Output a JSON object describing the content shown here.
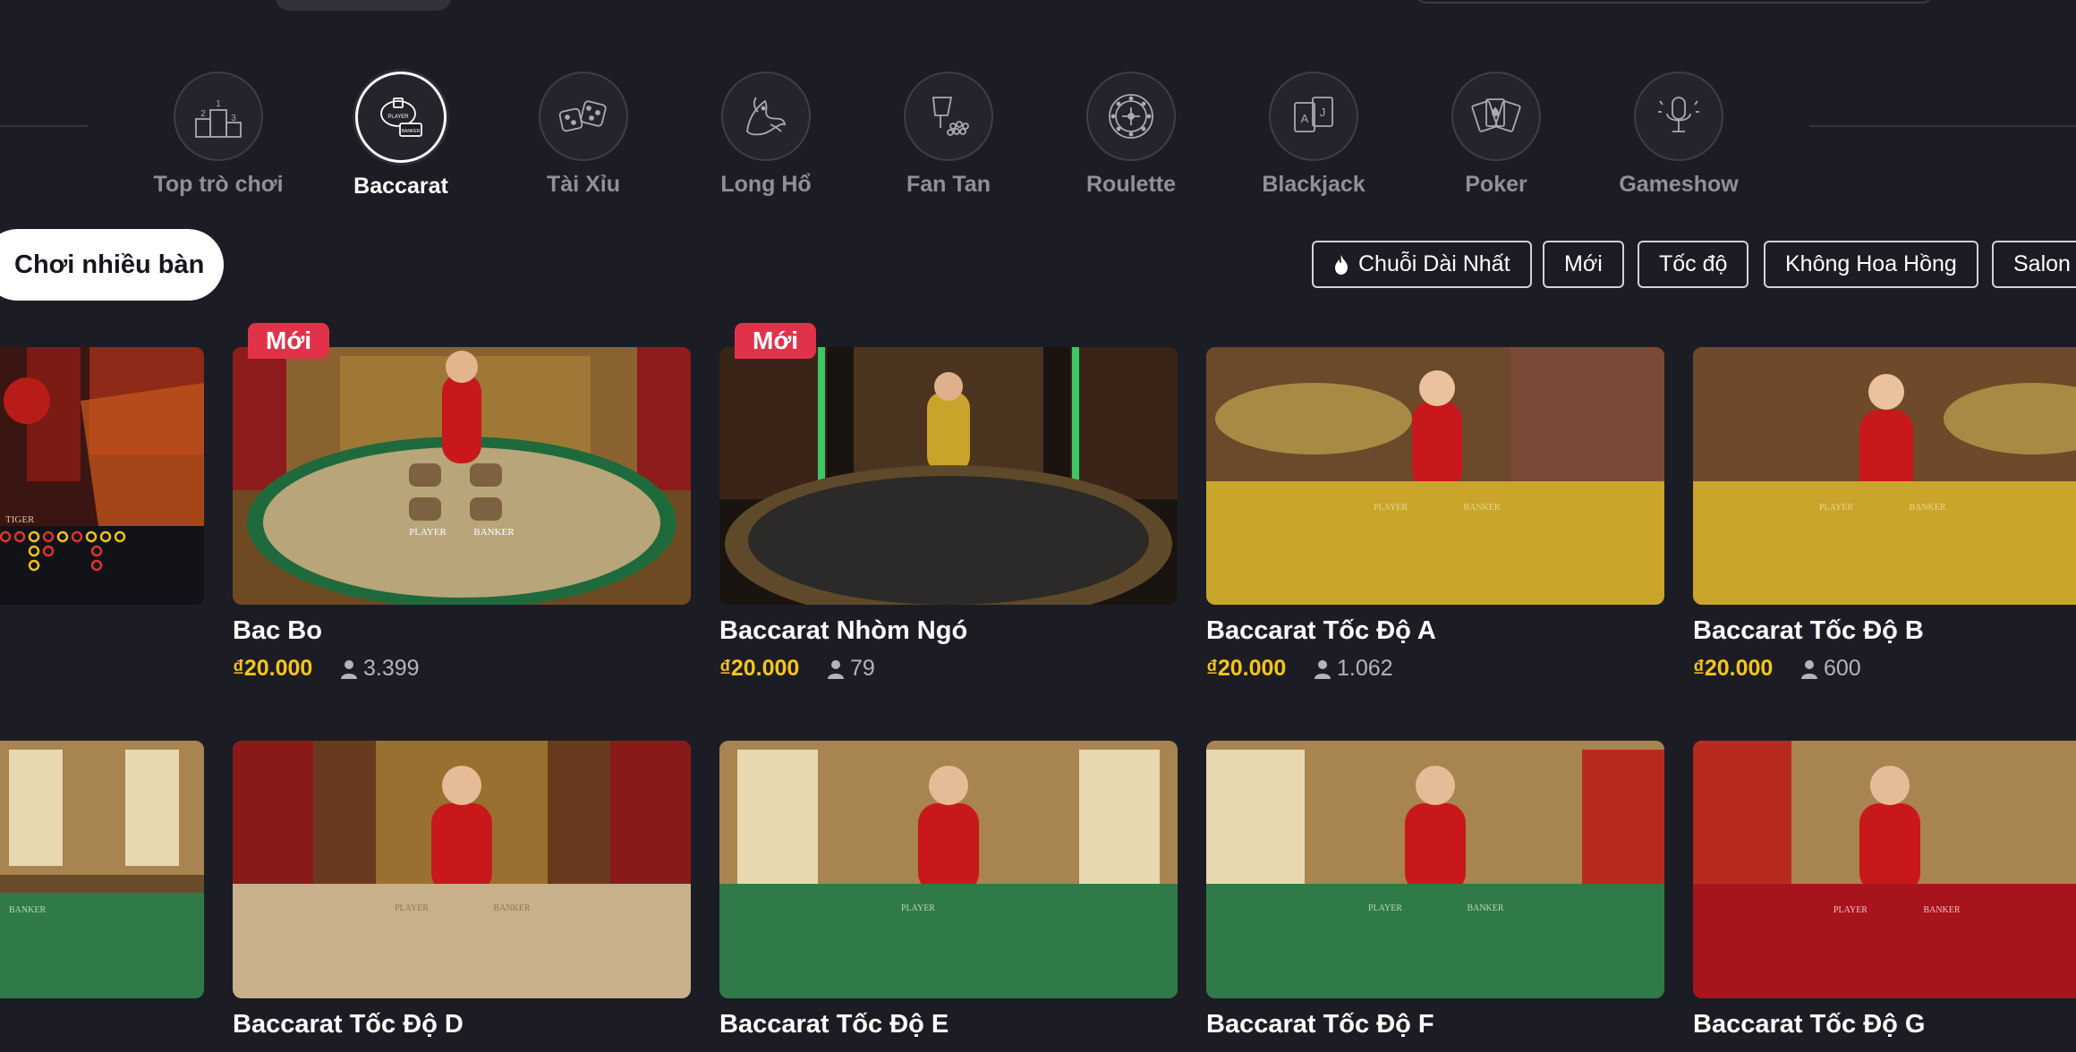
{
  "categories": [
    {
      "label": "Top trò chơi",
      "icon": "podium-icon"
    },
    {
      "label": "Baccarat",
      "icon": "baccarat-icon",
      "active": true
    },
    {
      "label": "Tài Xỉu",
      "icon": "dice-icon"
    },
    {
      "label": "Long Hổ",
      "icon": "dragon-tiger-icon"
    },
    {
      "label": "Fan Tan",
      "icon": "fan-tan-icon"
    },
    {
      "label": "Roulette",
      "icon": "roulette-icon"
    },
    {
      "label": "Blackjack",
      "icon": "blackjack-cards-icon"
    },
    {
      "label": "Poker",
      "icon": "poker-cards-icon"
    },
    {
      "label": "Gameshow",
      "icon": "microphone-icon"
    }
  ],
  "baccarat_icon_text": {
    "player": "PLAYER",
    "banker": "BANKER"
  },
  "multi_table_label": "Chơi nhiều bàn",
  "filters": [
    "Chuỗi Dài Nhất",
    "Mới",
    "Tốc độ",
    "Không Hoa Hồng",
    "Salon"
  ],
  "new_badge": "Mới",
  "games_row1": [
    {
      "name": "",
      "price": "",
      "players": ""
    },
    {
      "name": "Bac Bo",
      "price": "₫20.000",
      "players": "3.399",
      "new": true
    },
    {
      "name": "Baccarat Nhòm Ngó",
      "price": "₫20.000",
      "players": "79",
      "new": true
    },
    {
      "name": "Baccarat Tốc Độ A",
      "price": "₫20.000",
      "players": "1.062"
    },
    {
      "name": "Baccarat Tốc Độ B",
      "price": "₫20.000",
      "players": "600"
    }
  ],
  "games_row2": [
    {
      "name": ""
    },
    {
      "name": "Baccarat Tốc Độ D"
    },
    {
      "name": "Baccarat Tốc Độ E"
    },
    {
      "name": "Baccarat Tốc Độ F"
    },
    {
      "name": "Baccarat Tốc Độ G"
    }
  ],
  "thumb_text": {
    "tiger": "TIGER",
    "player": "PLAYER",
    "banker": "BANKER"
  },
  "colors": {
    "background": "#1c1d24",
    "price": "#f5c518",
    "badge": "#e0334a",
    "dealer_dress": "#c8181c"
  }
}
